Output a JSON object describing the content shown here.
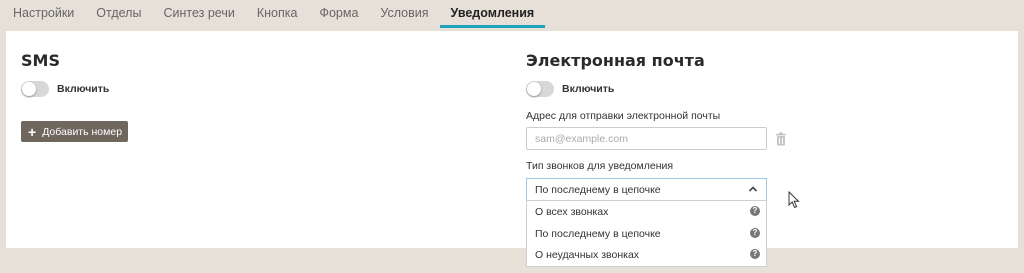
{
  "tabs": [
    {
      "label": "Настройки"
    },
    {
      "label": "Отделы"
    },
    {
      "label": "Синтез речи"
    },
    {
      "label": "Кнопка"
    },
    {
      "label": "Форма"
    },
    {
      "label": "Условия"
    },
    {
      "label": "Уведомления"
    }
  ],
  "active_tab": "Уведомления",
  "sms": {
    "title": "SMS",
    "toggle_label": "Включить",
    "toggle_on": false,
    "add_button": "Добавить номер"
  },
  "email": {
    "title": "Электронная почта",
    "toggle_label": "Включить",
    "toggle_on": false,
    "address_label": "Адрес для отправки электронной почты",
    "address_placeholder": "sam@example.com",
    "call_type_label": "Тип звонков для уведомления",
    "call_type_selected": "По последнему в цепочке",
    "call_type_options": [
      {
        "label": "О всех звонках"
      },
      {
        "label": "По последнему в цепочке"
      },
      {
        "label": "О неудачных звонках"
      }
    ]
  },
  "colors": {
    "background": "#e7e0d9",
    "active_tab_underline": "#1ea4b8",
    "button": "#6f665d"
  },
  "icons": {
    "add": "plus-icon",
    "delete": "trash-icon",
    "dropdown": "chevron-up-icon",
    "help": "question-circle-icon"
  }
}
